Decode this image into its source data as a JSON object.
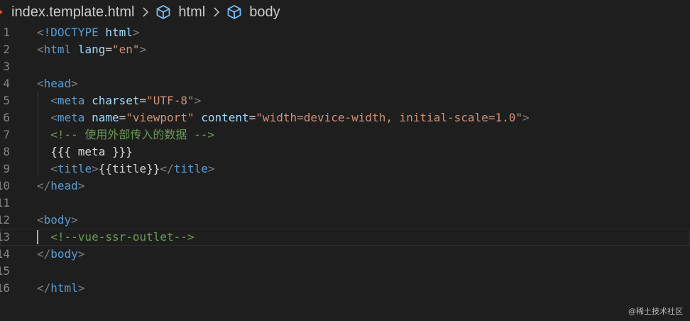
{
  "breadcrumb": {
    "file": "index.template.html",
    "items": [
      "html",
      "body"
    ]
  },
  "colors": {
    "background": "#1e1e1e",
    "tag": "#569cd6",
    "attribute": "#9cdcfe",
    "string": "#ce9178",
    "comment": "#6a9955",
    "punctuation": "#808080",
    "text": "#d4d4d4",
    "line_number": "#858585"
  },
  "editor": {
    "active_line": 13,
    "lines": [
      {
        "n": "1",
        "tokens": [
          [
            "br",
            "<"
          ],
          [
            "tag",
            "!DOCTYPE "
          ],
          [
            "attr",
            "html"
          ],
          [
            "br",
            ">"
          ]
        ]
      },
      {
        "n": "2",
        "tokens": [
          [
            "br",
            "<"
          ],
          [
            "tag",
            "html "
          ],
          [
            "attr",
            "lang"
          ],
          [
            "txt",
            "="
          ],
          [
            "str",
            "\"en\""
          ],
          [
            "br",
            ">"
          ]
        ]
      },
      {
        "n": "3",
        "tokens": []
      },
      {
        "n": "4",
        "tokens": [
          [
            "br",
            "<"
          ],
          [
            "tag",
            "head"
          ],
          [
            "br",
            ">"
          ]
        ]
      },
      {
        "n": "5",
        "tokens": [
          [
            "txt",
            "  "
          ],
          [
            "br",
            "<"
          ],
          [
            "tag",
            "meta "
          ],
          [
            "attr",
            "charset"
          ],
          [
            "txt",
            "="
          ],
          [
            "str",
            "\"UTF-8\""
          ],
          [
            "br",
            ">"
          ]
        ]
      },
      {
        "n": "6",
        "tokens": [
          [
            "txt",
            "  "
          ],
          [
            "br",
            "<"
          ],
          [
            "tag",
            "meta "
          ],
          [
            "attr",
            "name"
          ],
          [
            "txt",
            "="
          ],
          [
            "str",
            "\"viewport\""
          ],
          [
            "txt",
            " "
          ],
          [
            "attr",
            "content"
          ],
          [
            "txt",
            "="
          ],
          [
            "str",
            "\"width=device-width, initial-scale=1.0\""
          ],
          [
            "br",
            ">"
          ]
        ]
      },
      {
        "n": "7",
        "tokens": [
          [
            "txt",
            "  "
          ],
          [
            "com",
            "<!-- 使用外部传入的数据 -->"
          ]
        ]
      },
      {
        "n": "8",
        "tokens": [
          [
            "txt",
            "  {{{ meta }}}"
          ]
        ]
      },
      {
        "n": "9",
        "tokens": [
          [
            "txt",
            "  "
          ],
          [
            "br",
            "<"
          ],
          [
            "tag",
            "title"
          ],
          [
            "br",
            ">"
          ],
          [
            "txt",
            "{{title}}"
          ],
          [
            "br",
            "</"
          ],
          [
            "tag",
            "title"
          ],
          [
            "br",
            ">"
          ]
        ]
      },
      {
        "n": "10",
        "tokens": [
          [
            "br",
            "</"
          ],
          [
            "tag",
            "head"
          ],
          [
            "br",
            ">"
          ]
        ]
      },
      {
        "n": "11",
        "tokens": []
      },
      {
        "n": "12",
        "tokens": [
          [
            "br",
            "<"
          ],
          [
            "tag",
            "body"
          ],
          [
            "br",
            ">"
          ]
        ]
      },
      {
        "n": "13",
        "tokens": [
          [
            "txt",
            "  "
          ],
          [
            "com",
            "<!--vue-ssr-outlet-->"
          ]
        ]
      },
      {
        "n": "14",
        "tokens": [
          [
            "br",
            "</"
          ],
          [
            "tag",
            "body"
          ],
          [
            "br",
            ">"
          ]
        ]
      },
      {
        "n": "15",
        "tokens": []
      },
      {
        "n": "16",
        "tokens": [
          [
            "br",
            "</"
          ],
          [
            "tag",
            "html"
          ],
          [
            "br",
            ">"
          ]
        ]
      }
    ]
  },
  "watermark": "@稀土技术社区"
}
